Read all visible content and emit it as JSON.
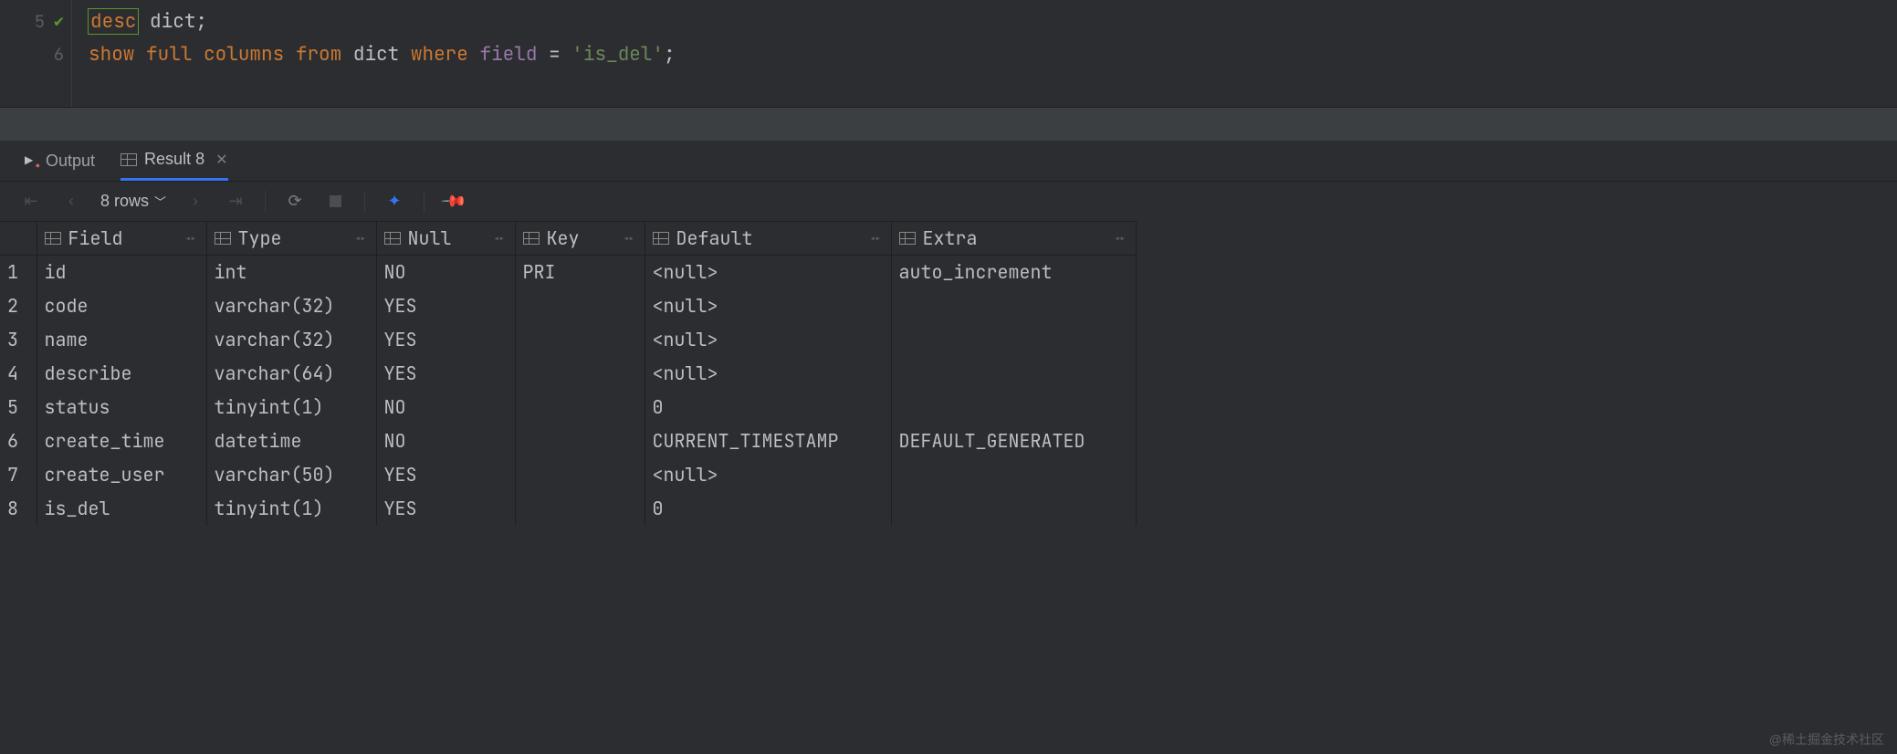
{
  "editor": {
    "lines": [
      {
        "num": "5",
        "has_run_marker": true
      },
      {
        "num": "6",
        "has_run_marker": false
      }
    ],
    "sql": {
      "l5": {
        "desc": "desc",
        "dict": "dict",
        "semi": ";"
      },
      "l6": {
        "show": "show",
        "full": "full",
        "columns": "columns",
        "from": "from",
        "dict": "dict",
        "where": "where",
        "field": "field",
        "eq": " = ",
        "val": "'is_del'",
        "semi": ";"
      }
    }
  },
  "tabs": {
    "output": "Output",
    "result": "Result 8"
  },
  "toolbar": {
    "rows_label": "8 rows"
  },
  "columns": [
    "Field",
    "Type",
    "Null",
    "Key",
    "Default",
    "Extra"
  ],
  "rows": [
    {
      "n": "1",
      "Field": "id",
      "Type": "int",
      "Null": "NO",
      "Key": "PRI",
      "Default": "<null>",
      "Extra": "auto_increment",
      "def_null": true
    },
    {
      "n": "2",
      "Field": "code",
      "Type": "varchar(32)",
      "Null": "YES",
      "Key": "",
      "Default": "<null>",
      "Extra": "",
      "def_null": true
    },
    {
      "n": "3",
      "Field": "name",
      "Type": "varchar(32)",
      "Null": "YES",
      "Key": "",
      "Default": "<null>",
      "Extra": "",
      "def_null": true
    },
    {
      "n": "4",
      "Field": "describe",
      "Type": "varchar(64)",
      "Null": "YES",
      "Key": "",
      "Default": "<null>",
      "Extra": "",
      "def_null": true
    },
    {
      "n": "5",
      "Field": "status",
      "Type": "tinyint(1)",
      "Null": "NO",
      "Key": "",
      "Default": "0",
      "Extra": "",
      "def_null": false
    },
    {
      "n": "6",
      "Field": "create_time",
      "Type": "datetime",
      "Null": "NO",
      "Key": "",
      "Default": "CURRENT_TIMESTAMP",
      "Extra": "DEFAULT_GENERATED",
      "def_null": false
    },
    {
      "n": "7",
      "Field": "create_user",
      "Type": "varchar(50)",
      "Null": "YES",
      "Key": "",
      "Default": "<null>",
      "Extra": "",
      "def_null": true
    },
    {
      "n": "8",
      "Field": "is_del",
      "Type": "tinyint(1)",
      "Null": "YES",
      "Key": "",
      "Default": "0",
      "Extra": "",
      "def_null": false
    }
  ],
  "watermark": "@稀土掘金技术社区"
}
